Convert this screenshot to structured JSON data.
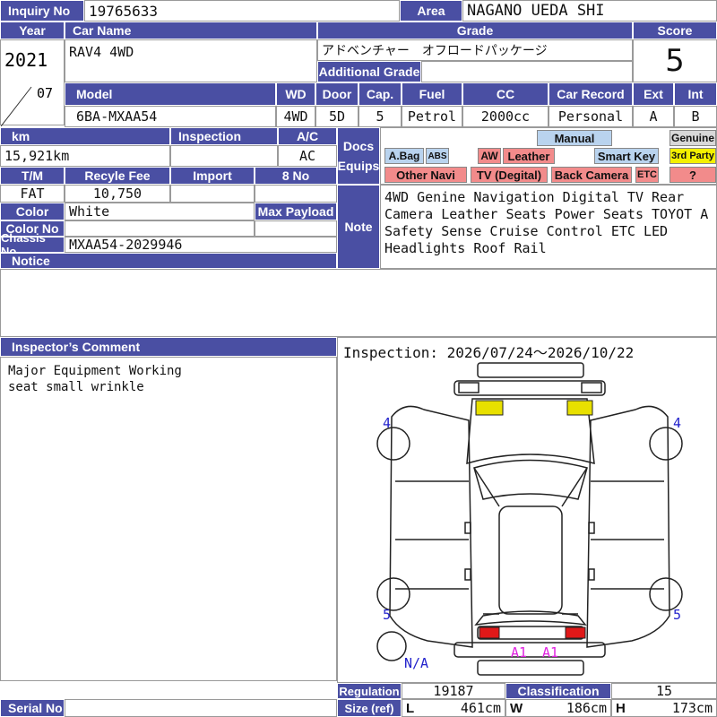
{
  "labels": {
    "inquiry_no": "Inquiry No",
    "area": "Area",
    "year": "Year",
    "car_name": "Car Name",
    "grade": "Grade",
    "score": "Score",
    "additional_grade": "Additional Grade",
    "model": "Model",
    "wd": "WD",
    "door": "Door",
    "cap": "Cap.",
    "fuel": "Fuel",
    "cc": "CC",
    "car_record": "Car Record",
    "ext": "Ext",
    "int": "Int",
    "km": "km",
    "inspection": "Inspection",
    "ac": "A/C",
    "docs_equips": "Docs Equips",
    "tm": "T/M",
    "recycle_fee": "Recyle Fee",
    "import": "Import",
    "eight_no": "8 No",
    "color": "Color",
    "max_payload": "Max Payload",
    "color_no": "Color No",
    "note": "Note",
    "chassis_no": "Chassis No",
    "notice": "Notice",
    "inspectors_comment": "Inspector’s Comment",
    "regulation": "Regulation",
    "classification": "Classification",
    "size_ref": "Size (ref)",
    "serial_no": "Serial No",
    "l": "L",
    "w": "W",
    "h": "H"
  },
  "values": {
    "inquiry_no": "19765633",
    "area": "NAGANO UEDA SHI",
    "year": "2021",
    "month": "07",
    "car_name": "RAV4 4WD",
    "grade": "アドベンチャー　オフロードパッケージ",
    "additional_grade": "",
    "score": "5",
    "model": "6BA-MXAA54",
    "wd": "4WD",
    "door": "5D",
    "cap": "5",
    "fuel": "Petrol",
    "cc": "2000cc",
    "car_record": "Personal",
    "ext": "A",
    "int": "B",
    "km": "15,921km",
    "inspection": "",
    "ac": "AC",
    "tm": "FAT",
    "recycle_fee": "10,750",
    "import": "",
    "eight_no": "",
    "color": "White",
    "max_payload": "",
    "color_no": "",
    "chassis_no": "MXAA54-2029946",
    "notice": "",
    "note": "4WD Genine Navigation Digital TV Rear Camera Leather Seats Power Seats TOYOT A Safety Sense Cruise Control ETC LED Headlights Roof Rail",
    "inspectors_comment": "Major Equipment Working\nseat small wrinkle",
    "inspection_period": "Inspection: 2026/07/24〜2026/10/22",
    "regulation": "19187",
    "classification": "15",
    "size_l": "461cm",
    "size_w": "186cm",
    "size_h": "173cm",
    "serial_no": ""
  },
  "equips": {
    "manual": "Manual",
    "genuine": "Genuine",
    "abag": "A.Bag",
    "abs": "ABS",
    "aw": "AW",
    "leather": "Leather",
    "smart_key": "Smart Key",
    "third_party": "3rd Party",
    "other_navi": "Other Navi",
    "tv_digital": "TV (Degital)",
    "back_camera": "Back Camera",
    "etc": "ETC",
    "question": "?"
  },
  "diagram": {
    "marks_tire": [
      "4",
      "4",
      "5",
      "5"
    ],
    "spare": "N/A",
    "rear_marks": [
      "A1",
      "A1"
    ]
  },
  "colors": {
    "header_bg": "#4a4fa3",
    "tag_red": "#f28b8b",
    "tag_blue": "#b9d3ee",
    "tag_yellow": "#f4f000",
    "mark_blue": "#2222cc",
    "mark_magenta": "#e020e0",
    "lamp_red": "#e01818",
    "lamp_yellow": "#e8e000"
  }
}
